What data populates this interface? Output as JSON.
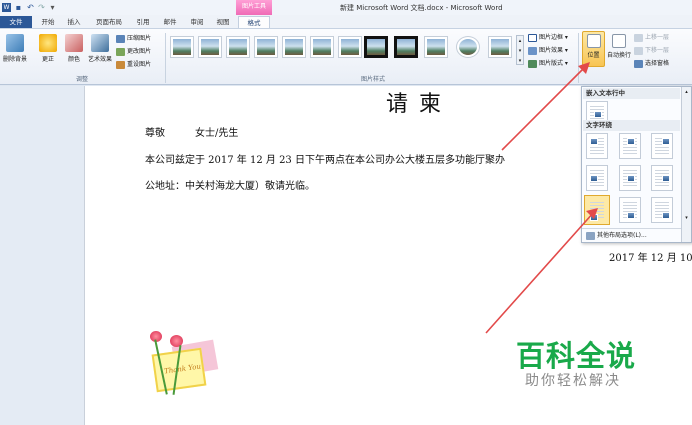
{
  "title_bar": {
    "window_title": "新建 Microsoft Word 文档.docx - Microsoft Word",
    "context_tab_group": "图片工具"
  },
  "ribbon_tabs": [
    "文件",
    "开始",
    "插入",
    "页面布局",
    "引用",
    "邮件",
    "审阅",
    "视图",
    "格式"
  ],
  "ribbon": {
    "adjust_group": {
      "remove_background": "删除背景",
      "corrections": "更正",
      "color": "颜色",
      "artistic_effects": "艺术效果",
      "compress": "压缩图片",
      "change": "更改图片",
      "reset": "重设图片",
      "label": "调整"
    },
    "styles_group": {
      "border": "图片边框",
      "effects": "图片效果",
      "layout": "图片版式",
      "label": "图片样式"
    },
    "arrange_group": {
      "position": "位置",
      "wrap_text": "自动换行",
      "bring_forward": "上移一层",
      "send_backward": "下移一层",
      "selection_pane": "选择窗格"
    }
  },
  "document": {
    "heading": "请 柬",
    "greeting_part1": "尊敬",
    "greeting_part2": "女士/先生",
    "body_line1": "本公司兹定于 2017 年 12 月 23 日下午两点在本公司办公大楼五层多功能厅聚办",
    "body_line2": "公地址：中关村海龙大厦）敬请光临。",
    "date": "2017 年 12 月 10",
    "card_text": "Thank You"
  },
  "position_dropdown": {
    "inline_header": "嵌入文本行中",
    "wrap_header": "文字环绕",
    "more_options": "其他布局选项(L)..."
  },
  "watermark": {
    "main": "百科全说",
    "sub": "助你轻松解决"
  }
}
